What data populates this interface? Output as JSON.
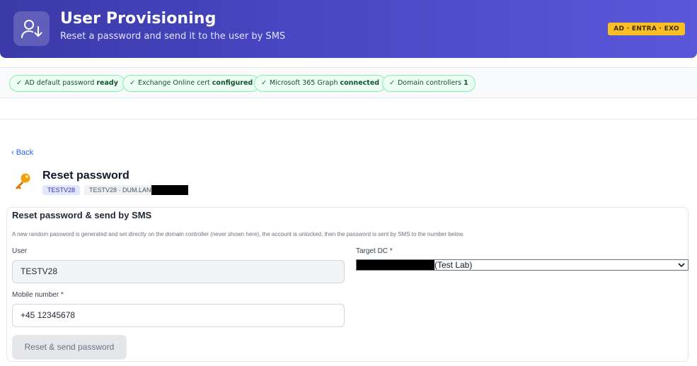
{
  "header": {
    "title": "User Provisioning",
    "subtitle": "Reset a password and send it to the user by SMS",
    "badge": "AD · ENTRA · EXO",
    "icon": "user-download-icon"
  },
  "status_chips": [
    {
      "label": "AD default password",
      "value": "ready"
    },
    {
      "label": "Exchange Online cert",
      "value": "configured"
    },
    {
      "label": "Microsoft 365 Graph",
      "value": "connected"
    },
    {
      "label": "Domain controllers",
      "value": "1"
    }
  ],
  "nav": {
    "back_label": "‹ Back"
  },
  "page": {
    "title": "Reset password",
    "icon": "key-icon",
    "tag_user": "TESTV28",
    "tag_dn": "TESTV28 · DUM.LAN"
  },
  "form": {
    "title": "Reset password & send by SMS",
    "description": "A new random password is generated and set directly on the domain controller (never shown here), the account is unlocked, then the password is sent by SMS to the number below.",
    "user_label": "User",
    "user_value": "TESTV28",
    "target_dc_label": "Target DC *",
    "target_dc_value": "(Test Lab)",
    "mobile_label": "Mobile number *",
    "mobile_value": "+45 12345678",
    "submit_label": "Reset & send password"
  },
  "colors": {
    "header_start": "#3b3aa8",
    "header_end": "#5b57d9",
    "badge": "#fbbf24",
    "chip_border": "#86efac",
    "link": "#2563eb"
  }
}
